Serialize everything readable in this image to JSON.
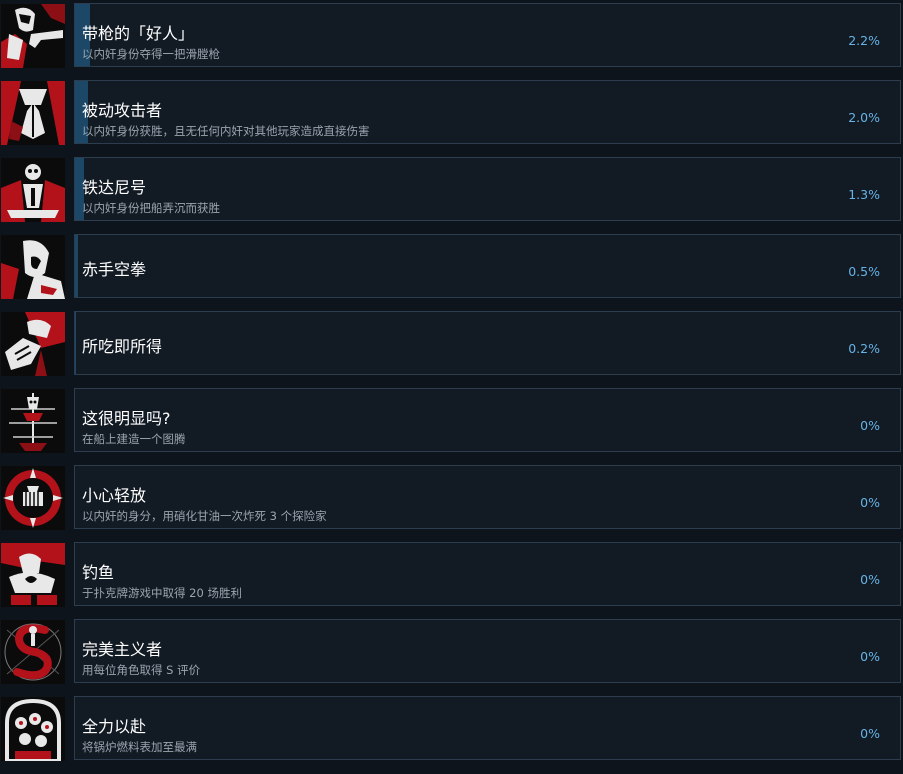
{
  "achievements": [
    {
      "title": "带枪的「好人」",
      "description": "以内奸身份夺得一把滑膛枪",
      "percent": "2.2%",
      "progress": 2.2,
      "icon": "gunman-icon"
    },
    {
      "title": "被动攻击者",
      "description": "以内奸身份获胜，且无任何内奸对其他玩家造成直接伤害",
      "percent": "2.0%",
      "progress": 2.0,
      "icon": "praying-hands-icon"
    },
    {
      "title": "铁达尼号",
      "description": "以内奸身份把船弄沉而获胜",
      "percent": "1.3%",
      "progress": 1.3,
      "icon": "sinking-ship-icon"
    },
    {
      "title": "赤手空拳",
      "description": "",
      "percent": "0.5%",
      "progress": 0.5,
      "icon": "screaming-face-icon"
    },
    {
      "title": "所吃即所得",
      "description": "",
      "percent": "0.2%",
      "progress": 0.2,
      "icon": "hand-over-mouth-icon"
    },
    {
      "title": "这很明显吗?",
      "description": "在船上建造一个图腾",
      "percent": "0%",
      "progress": 0,
      "icon": "totem-icon"
    },
    {
      "title": "小心轻放",
      "description": "以内奸的身分，用硝化甘油一次炸死 3 个探险家",
      "percent": "0%",
      "progress": 0,
      "icon": "explosion-icon"
    },
    {
      "title": "钓鱼",
      "description": "于扑克牌游戏中取得 20 场胜利",
      "percent": "0%",
      "progress": 0,
      "icon": "card-dealer-icon"
    },
    {
      "title": "完美主义者",
      "description": "用每位角色取得 S 评价",
      "percent": "0%",
      "progress": 0,
      "icon": "s-rank-icon"
    },
    {
      "title": "全力以赴",
      "description": "将锅炉燃料表加至最满",
      "percent": "0%",
      "progress": 0,
      "icon": "boiler-gauge-icon"
    }
  ],
  "colors": {
    "page_bg": "#0e141b",
    "card_bg": "#121a24",
    "card_border": "#2b3d4f",
    "progress_fill": "#1d4766",
    "title": "#ffffff",
    "description": "#9aa5ae",
    "percent": "#67b3e6",
    "icon_red": "#b3121b"
  }
}
